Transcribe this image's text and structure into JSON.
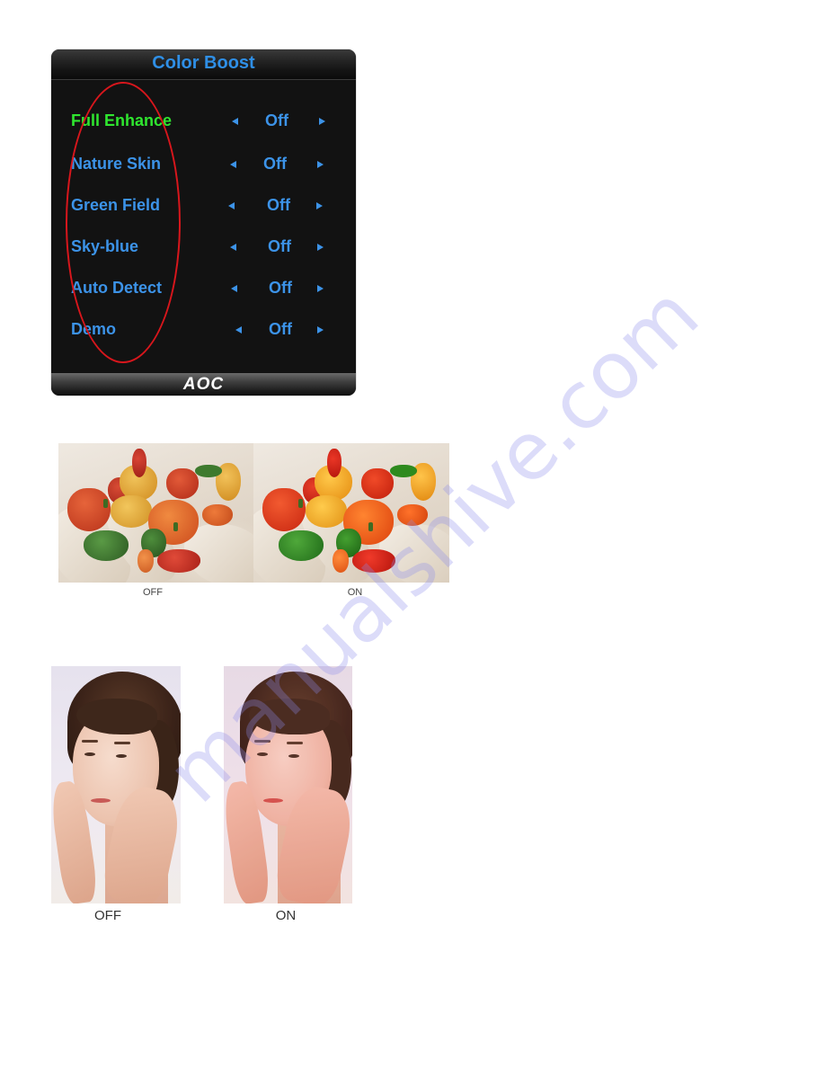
{
  "osd": {
    "title": "Color Boost",
    "logo": "AOC",
    "items": [
      {
        "label": "Full Enhance",
        "value": "Off",
        "active": true
      },
      {
        "label": "Nature Skin",
        "value": "Off",
        "active": false
      },
      {
        "label": "Green Field",
        "value": "Off",
        "active": false
      },
      {
        "label": "Sky-blue",
        "value": "Off",
        "active": false
      },
      {
        "label": "Auto Detect",
        "value": "Off",
        "active": false
      },
      {
        "label": "Demo",
        "value": "Off",
        "active": false
      }
    ],
    "colors": {
      "title": "#2f8fe6",
      "item": "#3c93e8",
      "active_item": "#2fe62f",
      "highlight_ellipse": "#d8161c"
    }
  },
  "comparisons": {
    "peppers": {
      "off_label": "OFF",
      "on_label": "ON"
    },
    "face": {
      "off_label": "OFF",
      "on_label": "ON"
    }
  },
  "watermark": "manualshive.com"
}
